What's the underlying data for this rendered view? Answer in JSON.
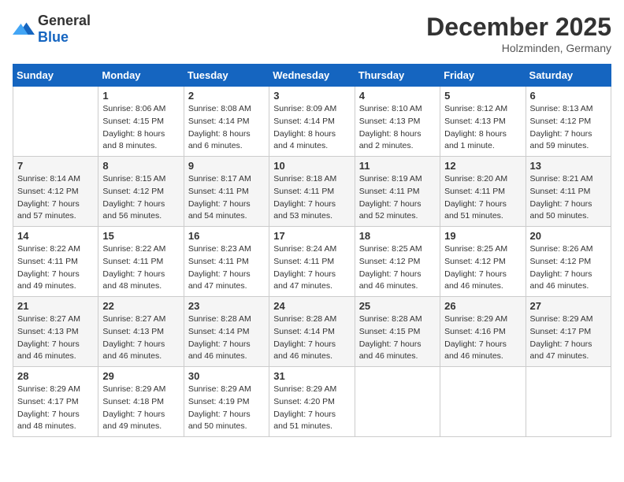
{
  "header": {
    "logo": {
      "general": "General",
      "blue": "Blue"
    },
    "title": "December 2025",
    "location": "Holzminden, Germany"
  },
  "weekdays": [
    "Sunday",
    "Monday",
    "Tuesday",
    "Wednesday",
    "Thursday",
    "Friday",
    "Saturday"
  ],
  "weeks": [
    [
      {
        "day": "",
        "sunrise": "",
        "sunset": "",
        "daylight": ""
      },
      {
        "day": "1",
        "sunrise": "Sunrise: 8:06 AM",
        "sunset": "Sunset: 4:15 PM",
        "daylight": "Daylight: 8 hours and 8 minutes."
      },
      {
        "day": "2",
        "sunrise": "Sunrise: 8:08 AM",
        "sunset": "Sunset: 4:14 PM",
        "daylight": "Daylight: 8 hours and 6 minutes."
      },
      {
        "day": "3",
        "sunrise": "Sunrise: 8:09 AM",
        "sunset": "Sunset: 4:14 PM",
        "daylight": "Daylight: 8 hours and 4 minutes."
      },
      {
        "day": "4",
        "sunrise": "Sunrise: 8:10 AM",
        "sunset": "Sunset: 4:13 PM",
        "daylight": "Daylight: 8 hours and 2 minutes."
      },
      {
        "day": "5",
        "sunrise": "Sunrise: 8:12 AM",
        "sunset": "Sunset: 4:13 PM",
        "daylight": "Daylight: 8 hours and 1 minute."
      },
      {
        "day": "6",
        "sunrise": "Sunrise: 8:13 AM",
        "sunset": "Sunset: 4:12 PM",
        "daylight": "Daylight: 7 hours and 59 minutes."
      }
    ],
    [
      {
        "day": "7",
        "sunrise": "Sunrise: 8:14 AM",
        "sunset": "Sunset: 4:12 PM",
        "daylight": "Daylight: 7 hours and 57 minutes."
      },
      {
        "day": "8",
        "sunrise": "Sunrise: 8:15 AM",
        "sunset": "Sunset: 4:12 PM",
        "daylight": "Daylight: 7 hours and 56 minutes."
      },
      {
        "day": "9",
        "sunrise": "Sunrise: 8:17 AM",
        "sunset": "Sunset: 4:11 PM",
        "daylight": "Daylight: 7 hours and 54 minutes."
      },
      {
        "day": "10",
        "sunrise": "Sunrise: 8:18 AM",
        "sunset": "Sunset: 4:11 PM",
        "daylight": "Daylight: 7 hours and 53 minutes."
      },
      {
        "day": "11",
        "sunrise": "Sunrise: 8:19 AM",
        "sunset": "Sunset: 4:11 PM",
        "daylight": "Daylight: 7 hours and 52 minutes."
      },
      {
        "day": "12",
        "sunrise": "Sunrise: 8:20 AM",
        "sunset": "Sunset: 4:11 PM",
        "daylight": "Daylight: 7 hours and 51 minutes."
      },
      {
        "day": "13",
        "sunrise": "Sunrise: 8:21 AM",
        "sunset": "Sunset: 4:11 PM",
        "daylight": "Daylight: 7 hours and 50 minutes."
      }
    ],
    [
      {
        "day": "14",
        "sunrise": "Sunrise: 8:22 AM",
        "sunset": "Sunset: 4:11 PM",
        "daylight": "Daylight: 7 hours and 49 minutes."
      },
      {
        "day": "15",
        "sunrise": "Sunrise: 8:22 AM",
        "sunset": "Sunset: 4:11 PM",
        "daylight": "Daylight: 7 hours and 48 minutes."
      },
      {
        "day": "16",
        "sunrise": "Sunrise: 8:23 AM",
        "sunset": "Sunset: 4:11 PM",
        "daylight": "Daylight: 7 hours and 47 minutes."
      },
      {
        "day": "17",
        "sunrise": "Sunrise: 8:24 AM",
        "sunset": "Sunset: 4:11 PM",
        "daylight": "Daylight: 7 hours and 47 minutes."
      },
      {
        "day": "18",
        "sunrise": "Sunrise: 8:25 AM",
        "sunset": "Sunset: 4:12 PM",
        "daylight": "Daylight: 7 hours and 46 minutes."
      },
      {
        "day": "19",
        "sunrise": "Sunrise: 8:25 AM",
        "sunset": "Sunset: 4:12 PM",
        "daylight": "Daylight: 7 hours and 46 minutes."
      },
      {
        "day": "20",
        "sunrise": "Sunrise: 8:26 AM",
        "sunset": "Sunset: 4:12 PM",
        "daylight": "Daylight: 7 hours and 46 minutes."
      }
    ],
    [
      {
        "day": "21",
        "sunrise": "Sunrise: 8:27 AM",
        "sunset": "Sunset: 4:13 PM",
        "daylight": "Daylight: 7 hours and 46 minutes."
      },
      {
        "day": "22",
        "sunrise": "Sunrise: 8:27 AM",
        "sunset": "Sunset: 4:13 PM",
        "daylight": "Daylight: 7 hours and 46 minutes."
      },
      {
        "day": "23",
        "sunrise": "Sunrise: 8:28 AM",
        "sunset": "Sunset: 4:14 PM",
        "daylight": "Daylight: 7 hours and 46 minutes."
      },
      {
        "day": "24",
        "sunrise": "Sunrise: 8:28 AM",
        "sunset": "Sunset: 4:14 PM",
        "daylight": "Daylight: 7 hours and 46 minutes."
      },
      {
        "day": "25",
        "sunrise": "Sunrise: 8:28 AM",
        "sunset": "Sunset: 4:15 PM",
        "daylight": "Daylight: 7 hours and 46 minutes."
      },
      {
        "day": "26",
        "sunrise": "Sunrise: 8:29 AM",
        "sunset": "Sunset: 4:16 PM",
        "daylight": "Daylight: 7 hours and 46 minutes."
      },
      {
        "day": "27",
        "sunrise": "Sunrise: 8:29 AM",
        "sunset": "Sunset: 4:17 PM",
        "daylight": "Daylight: 7 hours and 47 minutes."
      }
    ],
    [
      {
        "day": "28",
        "sunrise": "Sunrise: 8:29 AM",
        "sunset": "Sunset: 4:17 PM",
        "daylight": "Daylight: 7 hours and 48 minutes."
      },
      {
        "day": "29",
        "sunrise": "Sunrise: 8:29 AM",
        "sunset": "Sunset: 4:18 PM",
        "daylight": "Daylight: 7 hours and 49 minutes."
      },
      {
        "day": "30",
        "sunrise": "Sunrise: 8:29 AM",
        "sunset": "Sunset: 4:19 PM",
        "daylight": "Daylight: 7 hours and 50 minutes."
      },
      {
        "day": "31",
        "sunrise": "Sunrise: 8:29 AM",
        "sunset": "Sunset: 4:20 PM",
        "daylight": "Daylight: 7 hours and 51 minutes."
      },
      {
        "day": "",
        "sunrise": "",
        "sunset": "",
        "daylight": ""
      },
      {
        "day": "",
        "sunrise": "",
        "sunset": "",
        "daylight": ""
      },
      {
        "day": "",
        "sunrise": "",
        "sunset": "",
        "daylight": ""
      }
    ]
  ]
}
